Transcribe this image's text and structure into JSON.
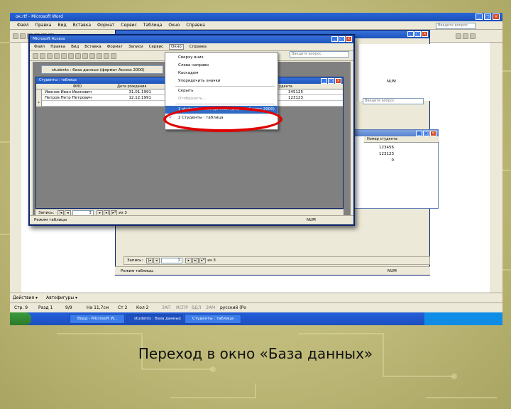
{
  "colors": {
    "slide_bg": "#bdb877",
    "highlight_ring": "#e00000",
    "menu_highlight": "#316ac5"
  },
  "word": {
    "title": "ок.rtf - Microsoft Word",
    "menu": [
      "Файл",
      "Правка",
      "Вид",
      "Вставка",
      "Формат",
      "Сервис",
      "Таблица",
      "Окно",
      "Справка"
    ],
    "help_placeholder": "Введите вопрос",
    "draw_label": "Действия ▾",
    "autoshapes": "Автофигуры ▾",
    "status": [
      "Стр. 9",
      "Разд 1",
      "9/9",
      "На 11,7см",
      "Ст 2",
      "Кол 2",
      "ЗАП",
      "ИСПР",
      "ВДЛ",
      "ЗАМ",
      "русский (Ро"
    ]
  },
  "access_back": {
    "help_placeholder": "Введите вопрос",
    "table_col": "Номер студента",
    "values": [
      "123456",
      "123123",
      "0"
    ],
    "nav_label": "Запись:",
    "nav_record": "1",
    "nav_total": "из 3",
    "status_left": "Режим таблицы",
    "status_right": "NUM",
    "num_top": "NUM"
  },
  "access": {
    "title": "Microsoft Access",
    "menu": [
      "Файл",
      "Правка",
      "Вид",
      "Вставка",
      "Формат",
      "Записи",
      "Сервис",
      "Окно",
      "Справка"
    ],
    "active_menu": "Окно",
    "help_placeholder": "Введите вопрос",
    "db_window_title": "students : база данных (формат Access 2000)",
    "table_title": "Студенты : таблица",
    "columns": {
      "fio": "ФИО",
      "dob": "Дата рождения",
      "num": "Номер студента"
    },
    "rows": [
      {
        "fio": "Иванов Иван Иванович",
        "dob": "31.01.1991",
        "num": "345125"
      },
      {
        "fio": "Петров Петр Петрович",
        "dob": "12.12.1991",
        "num": "123123"
      }
    ],
    "new_row_marker": "*",
    "nav_label": "Запись:",
    "nav_record": "3",
    "nav_total": "из 3",
    "status_left": "Режим таблицы",
    "status_right": "NUM"
  },
  "window_menu": {
    "items": [
      {
        "label": "Сверху вниз",
        "state": "normal"
      },
      {
        "label": "Слева направо",
        "state": "normal"
      },
      {
        "label": "Каскадом",
        "state": "normal"
      },
      {
        "label": "Упорядочить значки",
        "state": "normal"
      },
      {
        "label": "Скрыть",
        "state": "normal"
      },
      {
        "label": "Отобразить...",
        "state": "disabled"
      },
      {
        "label": "1 students : база данных (формат Access 2000)",
        "state": "highlighted"
      },
      {
        "label": "2 Студенты : таблица",
        "state": "checked"
      }
    ]
  },
  "taskbar": {
    "items": [
      "Ворд - Microsoft W...",
      "students : база данных ...",
      "Студенты : таблица"
    ]
  },
  "caption": "Переход в окно «База данных»"
}
